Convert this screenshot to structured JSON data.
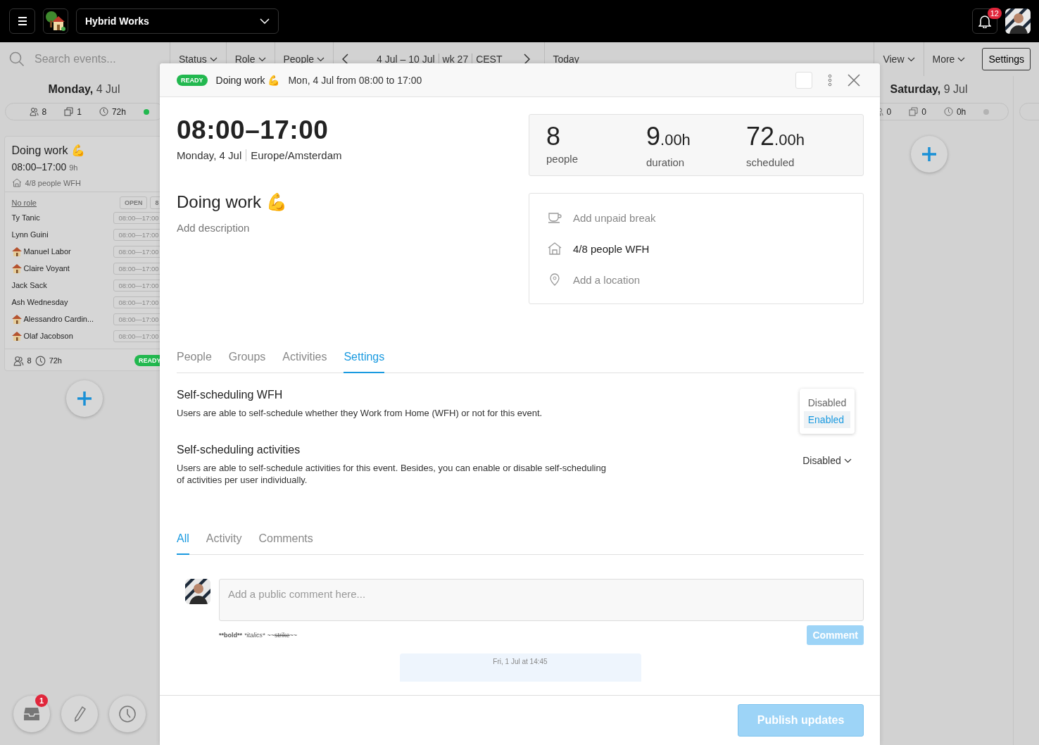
{
  "topbar": {
    "workspace": "Hybrid Works",
    "notifications": "12"
  },
  "toolbar": {
    "search_placeholder": "Search events...",
    "filters": [
      "Status",
      "Role",
      "People"
    ],
    "range": "4 Jul – 10 Jul",
    "week": "wk 27",
    "timezone": "CEST",
    "today": "Today",
    "menus": [
      "View",
      "More"
    ],
    "settings": "Settings"
  },
  "monday": {
    "weekday": "Monday,",
    "date": "4 Jul",
    "people": "8",
    "events": "1",
    "hours": "72h",
    "active": true,
    "card": {
      "title": "Doing work 💪",
      "time": "08:00–17:00",
      "duration": "9h",
      "wfh": "4/8 people WFH",
      "role": "No role",
      "open_label": "OPEN",
      "open_count": "8",
      "people": [
        {
          "name": "Ty Tanic",
          "wfh": false,
          "time": "08:00—17:00"
        },
        {
          "name": "Lynn Guini",
          "wfh": false,
          "time": "08:00—17:00"
        },
        {
          "name": "Manuel Labor",
          "wfh": true,
          "time": "08:00—17:00"
        },
        {
          "name": "Claire Voyant",
          "wfh": true,
          "time": "08:00—17:00"
        },
        {
          "name": "Jack Sack",
          "wfh": false,
          "time": "08:00—17:00"
        },
        {
          "name": "Ash Wednesday",
          "wfh": false,
          "time": "08:00—17:00"
        },
        {
          "name": "Alessandro Cardin...",
          "wfh": true,
          "time": "08:00—17:00"
        },
        {
          "name": "Olaf Jacobson",
          "wfh": true,
          "time": "08:00—17:00"
        }
      ],
      "footer_people": "8",
      "footer_hours": "72h",
      "status": "READY"
    }
  },
  "saturday": {
    "weekday": "Saturday,",
    "date": "9 Jul",
    "people": "0",
    "events": "0",
    "hours": "0h",
    "active": false
  },
  "dock": {
    "inbox_badge": "1"
  },
  "modal": {
    "status": "READY",
    "title": "Doing work 💪",
    "subtitle": "Mon, 4 Jul from 08:00 to 17:00",
    "checkbox": {
      "checked": false
    },
    "time_range": "08:00–17:00",
    "date": "Monday, 4 Jul",
    "timezone": "Europe/Amsterdam",
    "name": "Doing work 💪",
    "description_placeholder": "Add description",
    "stats": [
      {
        "value": "8",
        "label": "people"
      },
      {
        "value": "9",
        "unit": ".00h",
        "label": "duration"
      },
      {
        "value": "72",
        "unit": ".00h",
        "label": "scheduled"
      }
    ],
    "details": [
      {
        "kind": "break",
        "text": "Add unpaid break",
        "empty": true
      },
      {
        "kind": "wfh",
        "text": "4/8 people WFH",
        "empty": false
      },
      {
        "kind": "location",
        "text": "Add a location",
        "empty": true
      }
    ],
    "tabs": [
      {
        "label": "People",
        "selected": false
      },
      {
        "label": "Groups",
        "selected": false
      },
      {
        "label": "Activities",
        "selected": false
      },
      {
        "label": "Settings",
        "selected": true
      }
    ],
    "settings": [
      {
        "title": "Self-scheduling WFH",
        "description": "Users are able to self-schedule whether they Work from Home (WFH) or not for this event.",
        "control": {
          "kind": "menu",
          "options": [
            {
              "label": "Disabled",
              "selected": false
            },
            {
              "label": "Enabled",
              "selected": true
            }
          ]
        }
      },
      {
        "title": "Self-scheduling activities",
        "description": "Users are able to self-schedule activities for this event. Besides, you can enable or disable self-scheduling of activities per user individually.",
        "control": {
          "kind": "select",
          "value": "Disabled"
        }
      }
    ],
    "feed_tabs": [
      {
        "label": "All",
        "selected": true
      },
      {
        "label": "Activity",
        "selected": false
      },
      {
        "label": "Comments",
        "selected": false
      }
    ],
    "comment": {
      "placeholder": "Add a public comment here...",
      "hint": [
        {
          "text": "**bold**",
          "kind": "bold"
        },
        {
          "text": "*italics*",
          "kind": "italic"
        },
        {
          "text": "~~",
          "kind": "plain"
        },
        {
          "text": "strike",
          "kind": "strike"
        },
        {
          "text": "~~",
          "kind": "plain"
        }
      ],
      "button": "Comment"
    },
    "activity": [
      {
        "time": "Fri, 1 Jul at 14:45"
      }
    ],
    "publish": "Publish updates"
  }
}
